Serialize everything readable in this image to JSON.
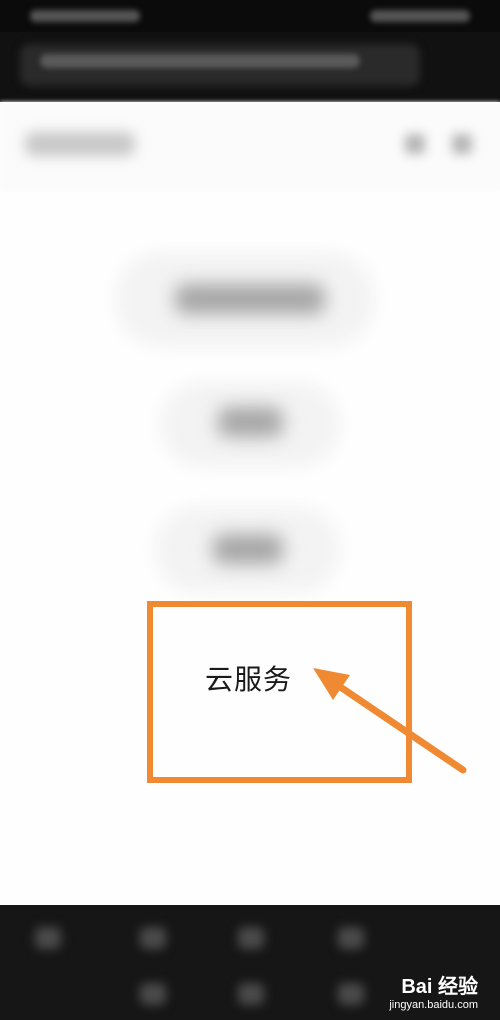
{
  "main": {
    "highlighted_item": "云服务"
  },
  "watermark": {
    "brand": "Bai 经验",
    "url": "jingyan.baidu.com"
  },
  "colors": {
    "annotation": "#f08a32",
    "status_bar": "#0b0b0b",
    "bottom_bar": "#161616"
  }
}
